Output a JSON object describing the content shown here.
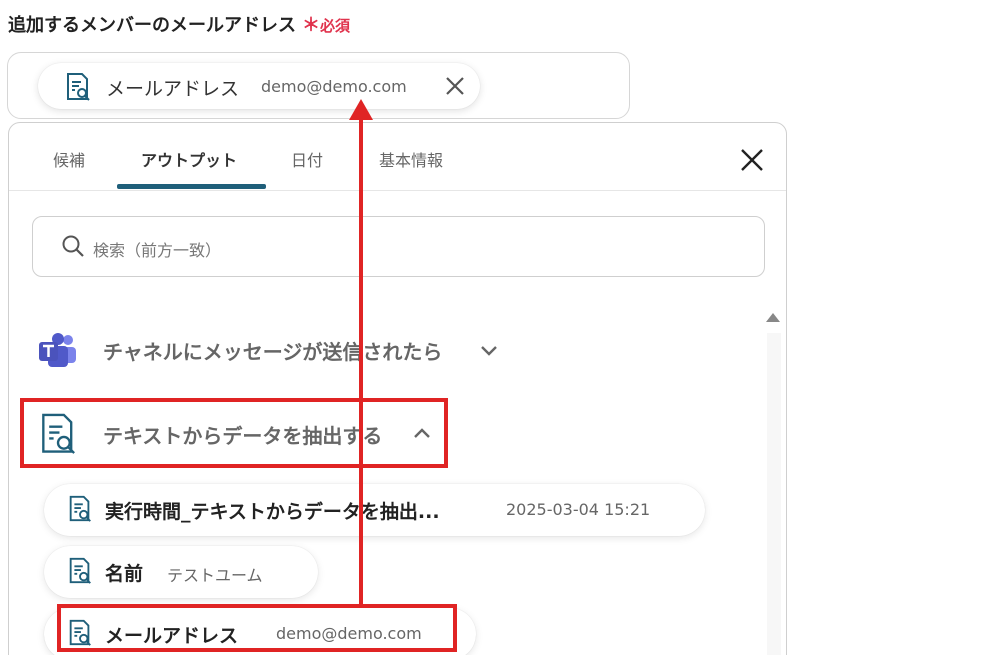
{
  "field": {
    "label": "追加するメンバーのメールアドレス",
    "required_mark": "＊",
    "required_text": "必須"
  },
  "token": {
    "label": "メールアドレス",
    "value": "demo@demo.com",
    "icon": "document-search-icon",
    "remove_icon": "close-icon"
  },
  "tabs": [
    {
      "label": "候補",
      "active": false
    },
    {
      "label": "アウトプット",
      "active": true
    },
    {
      "label": "日付",
      "active": false
    },
    {
      "label": "基本情報",
      "active": false
    }
  ],
  "search": {
    "placeholder": "検索（前方一致）"
  },
  "groups": [
    {
      "title": "チャネルにメッセージが送信されたら",
      "icon": "teams-icon",
      "expanded": false
    },
    {
      "title": "テキストからデータを抽出する",
      "icon": "document-search-icon",
      "expanded": true
    }
  ],
  "items": [
    {
      "label": "実行時間_テキストからデータを抽出...",
      "value": "2025-03-04 15:21"
    },
    {
      "label": "名前",
      "value": "テストユーム"
    },
    {
      "label": "メールアドレス",
      "value": "demo@demo.com"
    }
  ],
  "colors": {
    "accent": "#1f5f7a",
    "required": "#e0334d",
    "annotation": "#e02424",
    "teams": "#5059c9"
  }
}
